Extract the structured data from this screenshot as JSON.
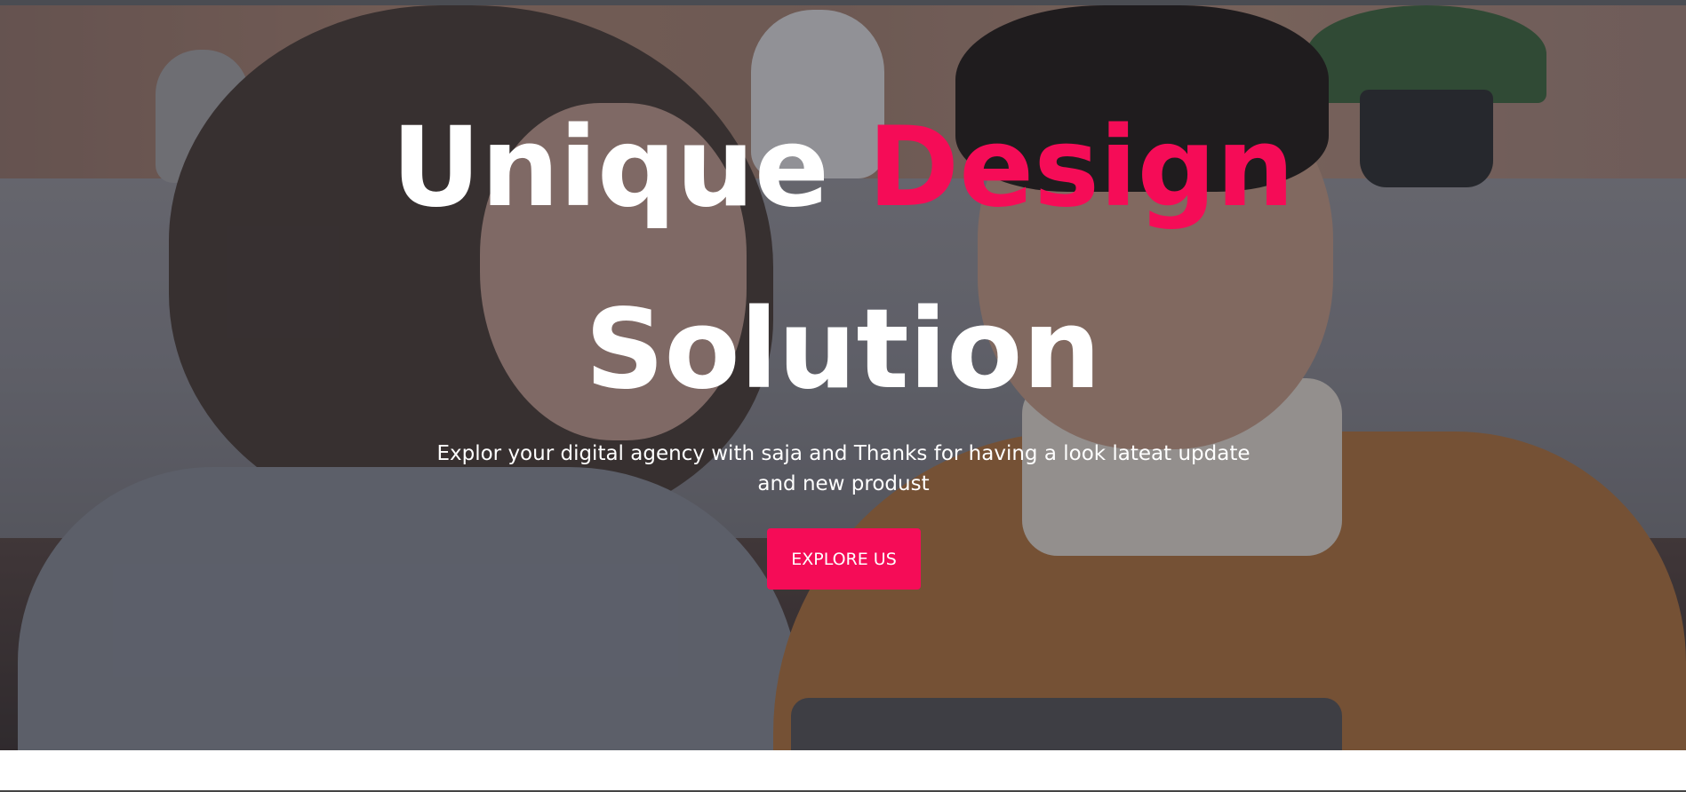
{
  "hero": {
    "headline_word_1": "Unique",
    "headline_word_2": "Design",
    "headline_line_2": "Solution",
    "subtext": "Explor your digital agency with saja and Thanks for having a look lateat update and new produst",
    "cta_label": "EXPLORE US"
  },
  "colors": {
    "accent": "#f50c57",
    "headline": "#ffffff",
    "overlay": "#1c1c24",
    "top_strip": "#4a4c52"
  }
}
